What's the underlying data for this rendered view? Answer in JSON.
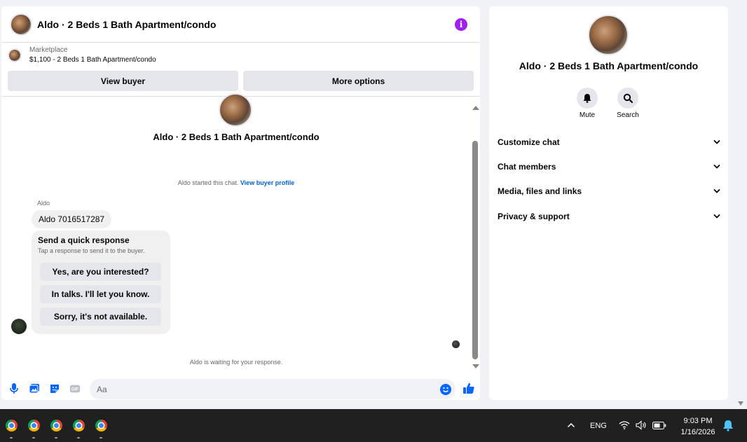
{
  "chat": {
    "header_title": "Aldo · 2 Beds 1 Bath Apartment/condo",
    "marketplace_label": "Marketplace",
    "listing_line": "$1,100 - 2 Beds 1 Bath Apartment/condo",
    "view_buyer_label": "View buyer",
    "more_options_label": "More options",
    "thread_title": "Aldo · 2 Beds 1 Bath Apartment/condo",
    "started_text": "Aldo started this chat.",
    "view_profile_link": "View buyer profile",
    "sender_name": "Aldo",
    "message_phone": "Aldo 7016517287",
    "quick_title": "Send a quick response",
    "quick_subtitle": "Tap a response to send it to the buyer.",
    "quick_responses": [
      "Yes, are you interested?",
      "In talks. I'll let you know.",
      "Sorry, it's not available."
    ],
    "waiting_text": "Aldo is waiting for your response.",
    "composer_placeholder": "Aa",
    "gif_label": "GIF"
  },
  "info": {
    "title": "Aldo · 2 Beds 1 Bath Apartment/condo",
    "mute_label": "Mute",
    "search_label": "Search",
    "sections": [
      "Customize chat",
      "Chat members",
      "Media, files and links",
      "Privacy & support"
    ]
  },
  "taskbar": {
    "language": "ENG",
    "time": "9:03 PM",
    "date": "1/16/2026"
  },
  "colors": {
    "accent": "#0866ff",
    "info_icon": "#a020f0",
    "link": "#0064d1"
  }
}
